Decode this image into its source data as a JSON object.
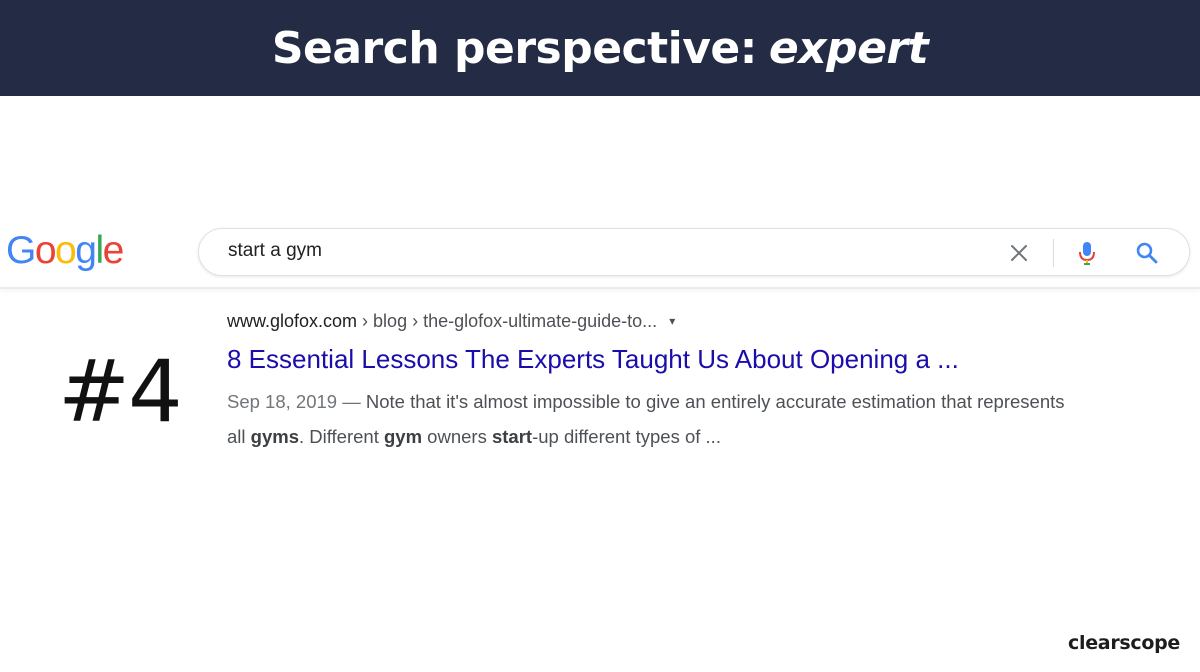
{
  "banner": {
    "title_prefix": "Search perspective:",
    "title_emphasis": "expert"
  },
  "logo": {
    "letters": [
      "G",
      "o",
      "o",
      "g",
      "l",
      "e"
    ],
    "colors": [
      "#4285f4",
      "#ea4335",
      "#fbbc05",
      "#4285f4",
      "#34a853",
      "#ea4335"
    ]
  },
  "search": {
    "query": "start a gym",
    "icons": [
      "close-icon",
      "microphone-icon",
      "search-icon"
    ]
  },
  "rank_label": "#4",
  "result": {
    "domain": "www.glofox.com",
    "path": " › blog › the-glofox-ultimate-guide-to...",
    "caret": "▾",
    "title": "8 Essential Lessons The Experts Taught Us About Opening a ...",
    "date": "Sep 18, 2019 — ",
    "snippet_parts": [
      {
        "text": "Note that it's almost impossible to give an entirely accurate estimation that represents all ",
        "bold": false
      },
      {
        "text": "gyms",
        "bold": true
      },
      {
        "text": ". Different ",
        "bold": false
      },
      {
        "text": "gym",
        "bold": true
      },
      {
        "text": " owners ",
        "bold": false
      },
      {
        "text": "start",
        "bold": true
      },
      {
        "text": "-up different types of ...",
        "bold": false
      }
    ]
  },
  "brand": "clearscope",
  "colors": {
    "banner_bg": "#232b45",
    "link_blue": "#1a0dab",
    "mic_blue": "#4285f4",
    "mic_red": "#ea4335",
    "search_blue": "#4285f4"
  }
}
